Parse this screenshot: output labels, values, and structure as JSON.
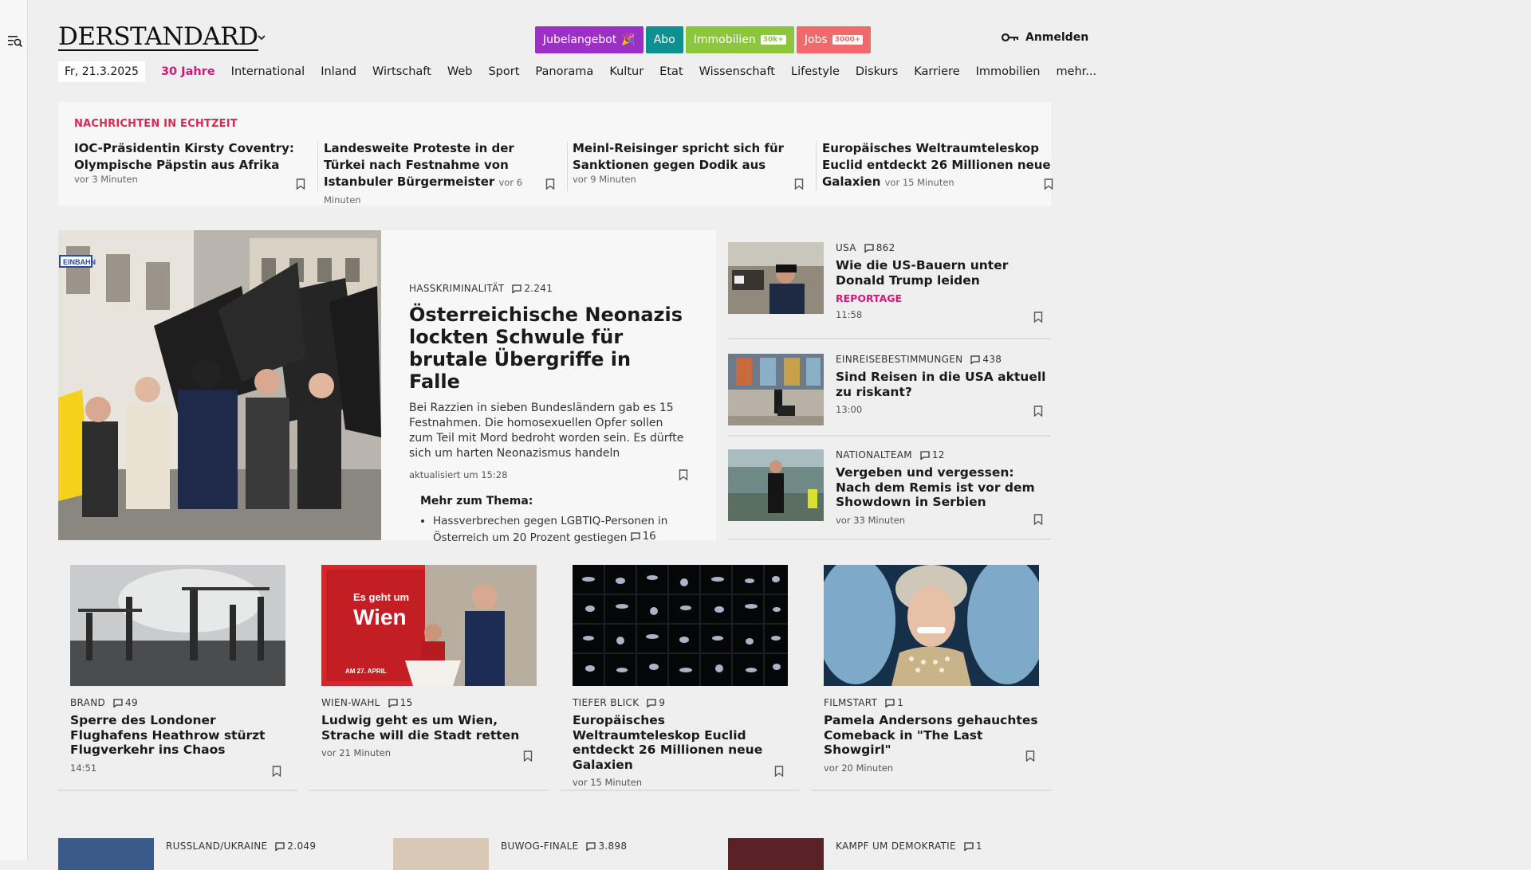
{
  "header": {
    "logo": "DERSTANDARD",
    "buttons": [
      {
        "label": "Jubelangebot",
        "color": "#9c2fc4",
        "tag": ""
      },
      {
        "label": "Abo",
        "color": "#0f8f8f",
        "tag": ""
      },
      {
        "label": "Immobilien",
        "color": "#8cc63f",
        "tag": "30k+"
      },
      {
        "label": "Jobs",
        "color": "#ef6b6b",
        "tag": "3000+"
      }
    ],
    "login_label": "Anmelden"
  },
  "nav": {
    "date": "Fr, 21.3.2025",
    "items": [
      "30 Jahre",
      "International",
      "Inland",
      "Wirtschaft",
      "Web",
      "Sport",
      "Panorama",
      "Kultur",
      "Etat",
      "Wissenschaft",
      "Lifestyle",
      "Diskurs",
      "Karriere",
      "Immobilien",
      "mehr..."
    ]
  },
  "ticker": {
    "heading": "NACHRICHTEN IN ECHTZEIT",
    "items": [
      {
        "title": "IOC-Präsidentin Kirsty Coventry: Olympische Päpstin aus Afrika",
        "time": "vor 3 Minuten"
      },
      {
        "title": "Landesweite Proteste in der Türkei nach Festnahme von Istanbuler Bürgermeister",
        "time": "vor 6 Minuten"
      },
      {
        "title": "Meinl-Reisinger spricht sich für Sanktionen gegen Dodik aus",
        "time": "vor 9 Minuten"
      },
      {
        "title": "Europäisches Weltraumteleskop Euclid entdeckt 26 Millionen neue Galaxien",
        "time": "vor 15 Minuten"
      }
    ]
  },
  "lead": {
    "kicker": "HASSKRIMINALITÄT",
    "comments": "2.241",
    "title": "Österreichische Neonazis lockten Schwule für brutale Übergriffe in Falle",
    "teaser": "Bei Razzien in sieben Bundesländern gab es 15 Festnahmen. Die homosexuellen Opfer sollen zum Teil mit Mord bedroht worden sein. Es dürfte sich um harten Neonazismus handeln",
    "updated": "aktualisiert um 15:28",
    "more_heading": "Mehr zum Thema:",
    "more_item": "Hassverbrechen gegen LGBTIQ-Personen in Österreich um 20 Prozent gestiegen",
    "more_item_comments": "16",
    "image_sign": "EINBAHN"
  },
  "right": [
    {
      "kicker": "USA",
      "comments": "862",
      "title": "Wie die US-Bauern unter Donald Trump leiden",
      "label": "REPORTAGE",
      "time": "11:58"
    },
    {
      "kicker": "EINREISEBESTIMMUNGEN",
      "comments": "438",
      "title": "Sind Reisen in die USA aktuell zu riskant?",
      "label": "",
      "time": "13:00"
    },
    {
      "kicker": "NATIONALTEAM",
      "comments": "12",
      "title": "Vergeben und vergessen: Nach dem Remis ist vor dem Showdown in Serbien",
      "label": "",
      "time": "vor 33 Minuten"
    }
  ],
  "cards": [
    {
      "kicker": "BRAND",
      "comments": "49",
      "title": "Sperre des Londoner Flughafens Heathrow stürzt Flugverkehr ins Chaos",
      "time": "14:51"
    },
    {
      "kicker": "WIEN-WAHL",
      "comments": "15",
      "title": "Ludwig geht es um Wien, Strache will die Stadt retten",
      "time": "vor 21 Minuten",
      "poster_line1": "Es geht um",
      "poster_line2": "Wien",
      "poster_date": "AM 27. APRIL"
    },
    {
      "kicker": "TIEFER BLICK",
      "comments": "9",
      "title": "Europäisches Weltraumteleskop Euclid entdeckt 26 Millionen neue Galaxien",
      "time": "vor 15 Minuten"
    },
    {
      "kicker": "FILMSTART",
      "comments": "1",
      "title": "Pamela Andersons gehauchtes Comeback in \"The Last Showgirl\"",
      "time": "vor 20 Minuten"
    }
  ],
  "bottom": [
    {
      "kicker": "RUSSLAND/UKRAINE",
      "comments": "2.049"
    },
    {
      "kicker": "BUWOG-FINALE",
      "comments": "3.898"
    },
    {
      "kicker": "KAMPF UM DEMOKRATIE",
      "comments": "1"
    }
  ]
}
